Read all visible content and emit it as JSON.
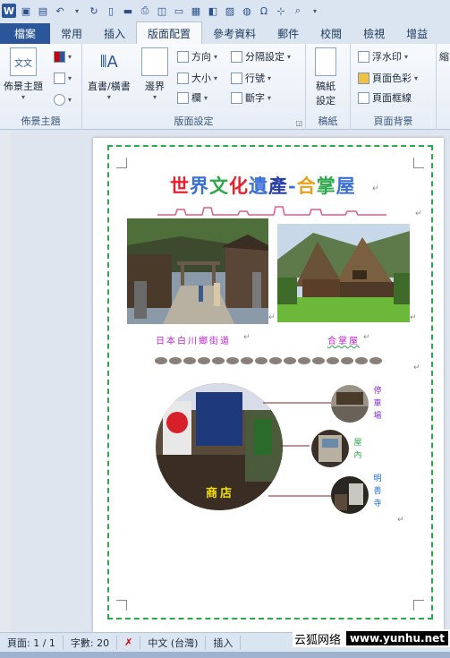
{
  "quick_access": {
    "icons": [
      "word-logo",
      "save-icon",
      "save-as-icon",
      "undo-icon",
      "redo-icon",
      "new-document-icon",
      "open-folder-icon",
      "print-icon",
      "print-preview-icon",
      "text-box-icon",
      "table-icon",
      "book-icon",
      "picture-icon",
      "internet-icon",
      "omega-icon",
      "org-chart-icon",
      "find-icon"
    ],
    "word_logo_letter": "W"
  },
  "tabs": {
    "file": "檔案",
    "home": "常用",
    "insert": "插入",
    "page_layout": "版面配置",
    "references": "參考資料",
    "mailings": "郵件",
    "review": "校閱",
    "view": "檢視",
    "more": "增益"
  },
  "ribbon": {
    "theme_group": {
      "label": "佈景主題",
      "themes_button": "佈景主題",
      "themes_icon_text": "文文"
    },
    "page_setup_group": {
      "label": "版面設定",
      "text_direction": "直書/橫書",
      "margins": "邊界",
      "orientation": "方向",
      "size": "大小",
      "columns": "欄",
      "breaks": "分隔設定",
      "line_numbers": "行號",
      "hyphenation": "斷字"
    },
    "draft_group": {
      "label": "稿紙",
      "draft_settings_line1": "稿紙",
      "draft_settings_line2": "設定"
    },
    "background_group": {
      "label": "頁面背景",
      "watermark": "浮水印",
      "page_color": "頁面色彩",
      "page_borders": "頁面框線"
    },
    "cut_label": "縮"
  },
  "document": {
    "title_chars": [
      {
        "ch": "世",
        "color": "#e8202a"
      },
      {
        "ch": "界",
        "color": "#3a6fd8"
      },
      {
        "ch": "文",
        "color": "#2aa84a"
      },
      {
        "ch": "化",
        "color": "#e8202a"
      },
      {
        "ch": "遺",
        "color": "#3a6fd8"
      },
      {
        "ch": "產",
        "color": "#2b3fa8"
      },
      {
        "ch": "-",
        "color": "#3a6fd8"
      },
      {
        "ch": "合",
        "color": "#e8a020"
      },
      {
        "ch": "掌",
        "color": "#2aa84a"
      },
      {
        "ch": "屋",
        "color": "#3a6fd8"
      }
    ],
    "caption_left": "日本白川鄉街道",
    "caption_right": "合掌屋",
    "circle_label": "商店",
    "side_labels": [
      {
        "text": "停車場",
        "color": "#8a2be2"
      },
      {
        "text": "屋內",
        "color": "#2aa84a"
      },
      {
        "text": "明善寺",
        "color": "#1e6fd8"
      }
    ]
  },
  "status": {
    "page": "頁面: 1 / 1",
    "words": "字數: 20",
    "language": "中文 (台灣)",
    "insert_mode": "插入"
  },
  "watermark": {
    "site_name": "云狐网络",
    "url": "www.yunhu.net"
  },
  "colors": {
    "file_tab": "#2b579a",
    "page_border": "#2aa84a",
    "accent": "#2b579a"
  }
}
